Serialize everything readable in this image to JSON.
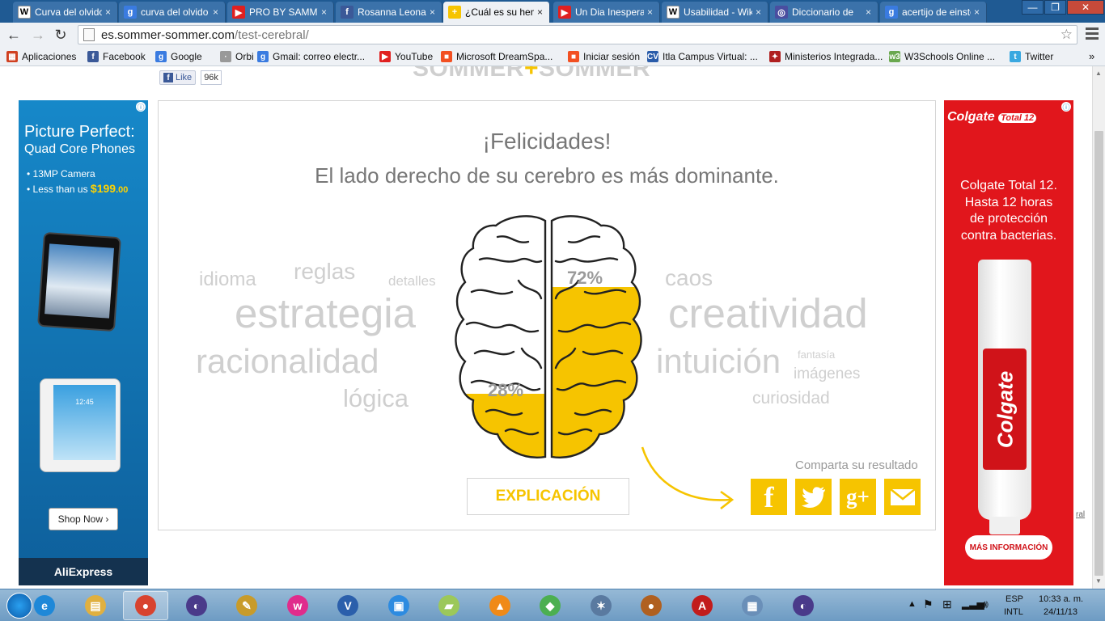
{
  "browser": {
    "tabs": [
      {
        "title": "Curva del olvido",
        "favicon": "W",
        "color": "#ffffff",
        "fg": "#000"
      },
      {
        "title": "curva del olvido",
        "favicon": "g",
        "color": "#3a7be0",
        "fg": "#fff"
      },
      {
        "title": "PRO BY SAMMY",
        "favicon": "▶",
        "color": "#e02020",
        "fg": "#fff"
      },
      {
        "title": "Rosanna Leonardo",
        "favicon": "f",
        "color": "#3b5998",
        "fg": "#fff"
      },
      {
        "title": "¿Cuál es su hemisferio",
        "favicon": "+",
        "color": "#f6c400",
        "fg": "#fff"
      },
      {
        "title": "Un Dia Inesperado",
        "favicon": "▶",
        "color": "#e02020",
        "fg": "#fff"
      },
      {
        "title": "Usabilidad - Wikipedia",
        "favicon": "W",
        "color": "#ffffff",
        "fg": "#000"
      },
      {
        "title": "Diccionario de",
        "favicon": "◎",
        "color": "#4a4ea0",
        "fg": "#fff"
      },
      {
        "title": "acertijo de einstein",
        "favicon": "g",
        "color": "#3a7be0",
        "fg": "#fff"
      }
    ],
    "tab_close": "×",
    "window_controls": {
      "minimize": "—",
      "restore": "❐",
      "close": "✕"
    },
    "nav": {
      "back": "←",
      "forward": "→",
      "reload": "↻"
    },
    "address": {
      "domain": "es.sommer-sommer.com",
      "path": "/test-cerebral/"
    },
    "star": "☆"
  },
  "bookmarks": [
    {
      "label": "Aplicaciones",
      "icon": "▦",
      "color": "#d04020"
    },
    {
      "label": "Facebook",
      "icon": "f",
      "color": "#3b5998"
    },
    {
      "label": "Google",
      "icon": "g",
      "color": "#3a7be0"
    },
    {
      "label": "Orbi",
      "icon": "·",
      "color": "#999999"
    },
    {
      "label": "Gmail: correo electr...",
      "icon": "g",
      "color": "#3a7be0"
    },
    {
      "label": "YouTube",
      "icon": "▶",
      "color": "#e02020"
    },
    {
      "label": "Microsoft DreamSpa...",
      "icon": "■",
      "color": "#f25022"
    },
    {
      "label": "Iniciar sesión",
      "icon": "■",
      "color": "#f25022"
    },
    {
      "label": "Itla Campus Virtual: ...",
      "icon": "CV",
      "color": "#2a5caa"
    },
    {
      "label": "Ministerios Integrada...",
      "icon": "✦",
      "color": "#b02020"
    },
    {
      "label": "W3Schools Online ...",
      "icon": "w3",
      "color": "#6aa84f"
    },
    {
      "label": "Twitter",
      "icon": "t",
      "color": "#3aa8e0"
    }
  ],
  "bookmarks_more": "»",
  "page": {
    "fb_like": {
      "label": "Like",
      "count": "96k"
    },
    "logo": {
      "left": "SOMMER",
      "plus": "+",
      "right": "SOMMER"
    },
    "result": {
      "congrats": "¡Felicidades!",
      "headline": "El lado derecho de su cerebro es más dominante.",
      "left_pct": "28%",
      "right_pct": "72%",
      "left_fill": 0.28,
      "right_fill": 0.72,
      "left_words": [
        "idioma",
        "reglas",
        "detalles",
        "estrategia",
        "racionalidad",
        "lógica"
      ],
      "right_words": [
        "caos",
        "creatividad",
        "intuición",
        "fantasía",
        "imágenes",
        "curiosidad"
      ],
      "explain_button": "EXPLICACIÓN",
      "share_label": "Comparta su resultado",
      "share": [
        {
          "name": "facebook",
          "glyph": "f"
        },
        {
          "name": "twitter",
          "glyph": "t"
        },
        {
          "name": "google-plus",
          "glyph": "g+"
        },
        {
          "name": "email",
          "glyph": "✉"
        }
      ]
    },
    "ad_left": {
      "title1": "Picture Perfect:",
      "title2": "Quad Core Phones",
      "bullet1": "• 13MP Camera",
      "bullet2_prefix": "• Less than us ",
      "bullet2_price": "$199",
      "bullet2_cents": ".00",
      "phone_time": "12:45",
      "cta": "Shop Now ›",
      "brand": "AliExpress",
      "info": "ⓘ"
    },
    "ad_right": {
      "brand": "Colgate",
      "brand_badge": "Total 12",
      "copy1": "Colgate Total 12.",
      "copy2": "Hasta 12 horas",
      "copy3": "de protección",
      "copy4": "contra bacterias.",
      "tube_word": "Colgate",
      "cta": "MÁS INFORMACIÓN",
      "info": "ⓘ"
    },
    "edge_link": "ral"
  },
  "taskbar": {
    "apps": [
      {
        "name": "internet-explorer",
        "glyph": "e",
        "color": "#1e88d8"
      },
      {
        "name": "file-explorer",
        "glyph": "▤",
        "color": "#e0b040"
      },
      {
        "name": "chrome",
        "glyph": "●",
        "color": "#d8432f"
      },
      {
        "name": "eclipse",
        "glyph": "◐",
        "color": "#4a3a8a"
      },
      {
        "name": "tools",
        "glyph": "✎",
        "color": "#c89b2a"
      },
      {
        "name": "wamp",
        "glyph": "w",
        "color": "#e02c8c"
      },
      {
        "name": "visio",
        "glyph": "V",
        "color": "#2b5fab"
      },
      {
        "name": "blend",
        "glyph": "▣",
        "color": "#2d8be0"
      },
      {
        "name": "sticky-notes",
        "glyph": "▰",
        "color": "#9cc85a"
      },
      {
        "name": "vlc",
        "glyph": "▲",
        "color": "#f08a18"
      },
      {
        "name": "sims",
        "glyph": "◆",
        "color": "#4caf50"
      },
      {
        "name": "game",
        "glyph": "✶",
        "color": "#5a7aa0"
      },
      {
        "name": "baseball-glove",
        "glyph": "●",
        "color": "#b06020"
      },
      {
        "name": "acrobat",
        "glyph": "A",
        "color": "#c21c1c"
      },
      {
        "name": "calculator",
        "glyph": "▦",
        "color": "#6a8fb8"
      },
      {
        "name": "eclipse-2",
        "glyph": "◐",
        "color": "#4a3a8a"
      }
    ],
    "lang_top": "ESP",
    "lang_bottom": "INTL",
    "time": "10:33 a. m.",
    "date": "24/11/13",
    "tray_up": "▲"
  }
}
